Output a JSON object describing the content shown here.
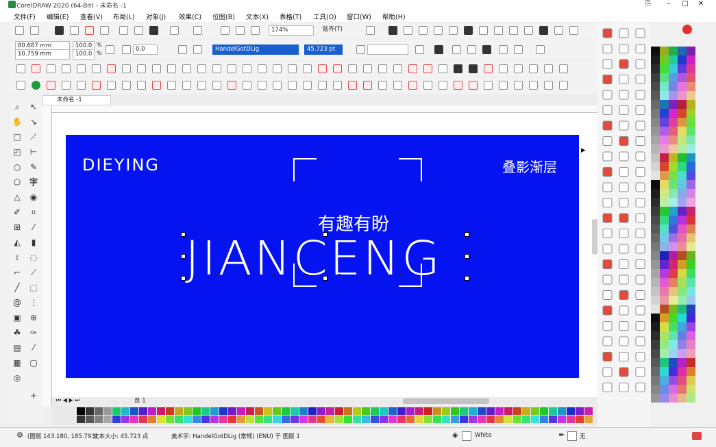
{
  "app": {
    "title": "CorelDRAW 2020 (64-Bit) - 未命名 -1"
  },
  "window_controls": {
    "restore": "⎘",
    "minimize": "–",
    "maximize": "□",
    "close": "✕"
  },
  "menu": [
    "文件(F)",
    "编辑(E)",
    "查看(V)",
    "布局(L)",
    "对象(J)",
    "效果(C)",
    "位图(B)",
    "文本(X)",
    "表格(T)",
    "工具(O)",
    "窗口(W)",
    "帮助(H)"
  ],
  "standard_toolbar": {
    "zoom": "174%",
    "snap_label": "贴齐(T)"
  },
  "property_bar": {
    "x": "80.687 mm",
    "y": "10.759 mm",
    "scale_w": "100.0",
    "scale_h": "100.0",
    "percent": "%",
    "rotation": "0.0",
    "font_name": "HandelGotDLig",
    "font_size": "45.723 pt"
  },
  "document": {
    "tab_label": "未命名 -1",
    "page_label": "页 1"
  },
  "canvas": {
    "brand_text": "DIEYING",
    "corner_text": "叠影渐层",
    "slogan": "有趣有盼",
    "main_text": "JIANCENG",
    "background_color": "#0513F0"
  },
  "status": {
    "coords": "(图层 143.180, 185.793)",
    "text_size": "文本大小: 45.723 点",
    "art_text": "美术字: HandelGotDLig (常规) (ENU) 于 图层 1",
    "fill_color": "White",
    "outline": "无"
  },
  "icons": {
    "tool_text": "字"
  }
}
